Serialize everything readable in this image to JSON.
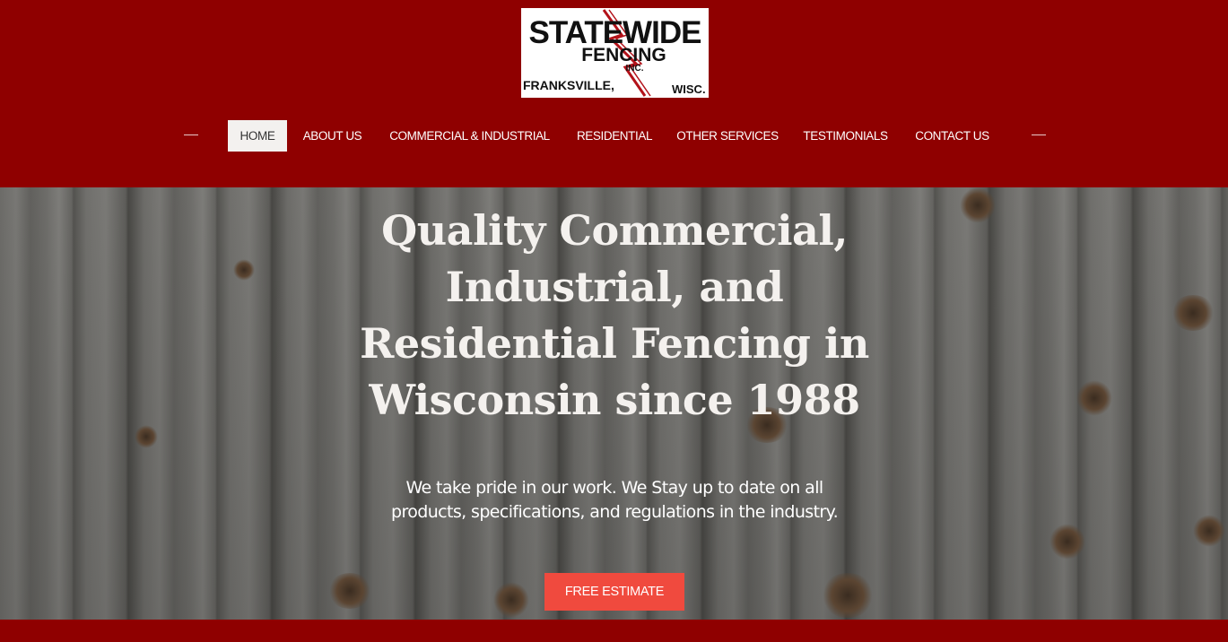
{
  "brand": {
    "logo_line1": "STATEWIDE",
    "logo_line2": "FENCING",
    "logo_line3": "INC.",
    "logo_city": "FRANKSVILLE,",
    "logo_state": "WISC."
  },
  "nav": {
    "items": [
      {
        "label": "HOME",
        "active": true
      },
      {
        "label": "ABOUT US",
        "active": false
      },
      {
        "label": "COMMERCIAL & INDUSTRIAL",
        "active": false
      },
      {
        "label": "RESIDENTIAL",
        "active": false
      },
      {
        "label": "OTHER SERVICES",
        "active": false
      },
      {
        "label": "TESTIMONIALS",
        "active": false
      },
      {
        "label": "CONTACT US",
        "active": false
      }
    ]
  },
  "hero": {
    "title_line1": "Quality Commercial,",
    "title_line2": "Industrial, and",
    "title_line3": "Residential Fencing in",
    "title_line4": "Wisconsin since 1988",
    "subtitle_line1": "We take pride in our work. We Stay up to date on all",
    "subtitle_line2": "products, specifications, and regulations in the industry.",
    "cta_label": "FREE ESTIMATE"
  },
  "colors": {
    "header_bg": "#8f0000",
    "cta_bg": "#f04a3e",
    "active_nav_bg": "#f3f1ef"
  }
}
